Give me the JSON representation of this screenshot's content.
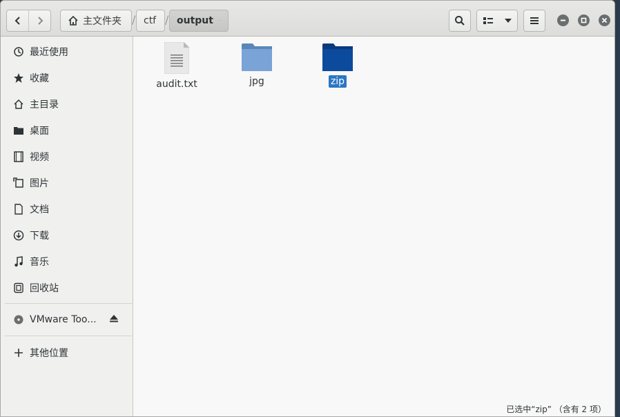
{
  "header": {
    "back_label": "back",
    "forward_label": "forward",
    "breadcrumbs": [
      "主文件夹",
      "ctf",
      "output"
    ],
    "separator": "/"
  },
  "sidebar": {
    "items": [
      {
        "label": "最近使用",
        "icon": "clock-icon"
      },
      {
        "label": "收藏",
        "icon": "star-icon"
      },
      {
        "label": "主目录",
        "icon": "home-icon"
      },
      {
        "label": "桌面",
        "icon": "folder-icon"
      },
      {
        "label": "视频",
        "icon": "film-icon"
      },
      {
        "label": "图片",
        "icon": "image-icon"
      },
      {
        "label": "文档",
        "icon": "document-icon"
      },
      {
        "label": "下载",
        "icon": "download-icon"
      },
      {
        "label": "音乐",
        "icon": "music-icon"
      },
      {
        "label": "回收站",
        "icon": "trash-icon"
      }
    ],
    "device": {
      "label": "VMware Too...",
      "icon": "disc-icon"
    },
    "other": {
      "label": "其他位置",
      "icon": "plus-icon"
    }
  },
  "files": [
    {
      "name": "audit.txt",
      "type": "text-file-icon",
      "selected": false
    },
    {
      "name": "jpg",
      "type": "folder-icon",
      "selected": false
    },
    {
      "name": "zip",
      "type": "folder-icon",
      "selected": true
    }
  ],
  "status": "已选中“zip” （含有 2 项）",
  "colors": {
    "selection": "#2a76c6",
    "folder": "#7aa3d8",
    "folder_selected": "#0b4a9c"
  }
}
